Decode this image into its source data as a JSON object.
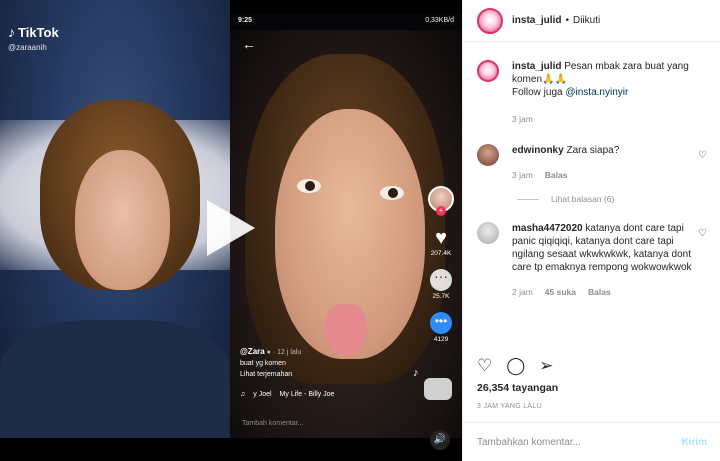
{
  "media": {
    "tiktok_brand": "TikTok",
    "tiktok_handle": "@zaraanih",
    "phone_time": "9:25",
    "phone_status": "0,33KB/d",
    "likes": "207.4K",
    "comments": "25.7K",
    "shares": "4129",
    "video_user": "@Zara",
    "video_time": "12 j lalu",
    "caption": "buat yg komen",
    "translate": "Lihat terjemahan",
    "music_artist": "y Joel",
    "music_title": "My Life - Billy Joe",
    "comment_placeholder": "Tambah komentar..."
  },
  "post": {
    "username": "insta_julid",
    "follow_status": "Diikuti",
    "caption_user": "insta_julid",
    "caption_text": "Pesan mbak zara buat yang komen🙏🙏",
    "caption_follow": "Follow juga",
    "caption_link": "@insta.nyinyir",
    "caption_time": "3 jam"
  },
  "comments": [
    {
      "user": "edwinonky",
      "text": "Zara siapa?",
      "time": "3 jam",
      "reply_label": "Balas",
      "view_replies": "Lihat balasan (6)"
    },
    {
      "user": "masha4472020",
      "text": "katanya dont care tapi panic qiqiqiqi, katanya dont care tapi ngilang sesaat wkwkwkwk, katanya dont care tp emaknya rempong wokwowkwok",
      "time": "2 jam",
      "likes": "45 suka",
      "reply_label": "Balas"
    }
  ],
  "footer": {
    "views": "26,354 tayangan",
    "time_ago": "3 JAM YANG LALU",
    "comment_placeholder": "Tambahkan komentar...",
    "post_label": "Kirim"
  },
  "icons": {
    "like": "heart-icon",
    "comment": "comment-icon",
    "share": "paper-plane-icon"
  },
  "colors": {
    "link": "#003569",
    "story_ring": "#e1306c",
    "post_disabled": "#b2dffc",
    "tiktok_red": "#fe2c55"
  }
}
